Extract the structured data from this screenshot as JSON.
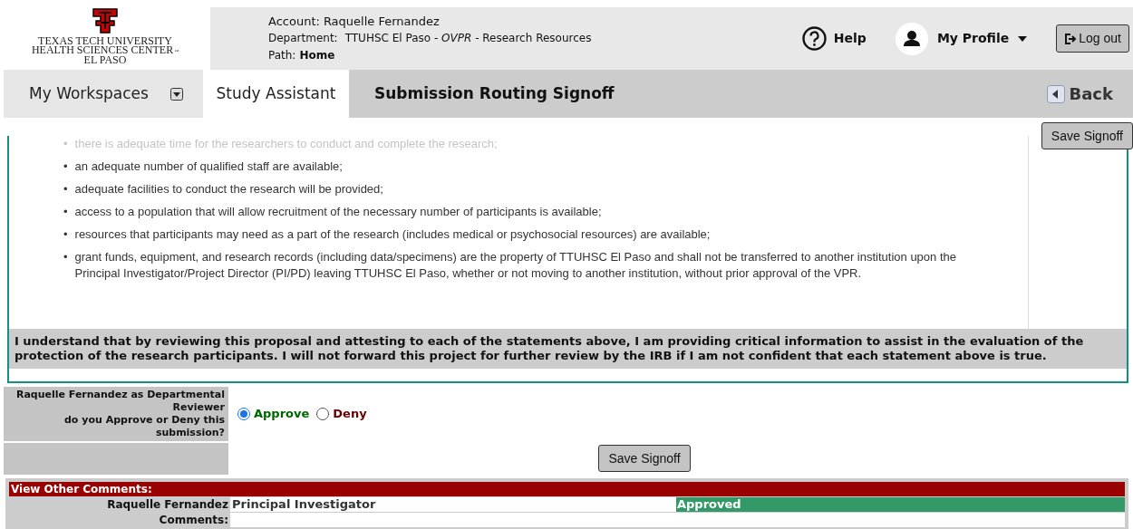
{
  "logo": {
    "lines": [
      "TEXAS TECH UNIVERSITY",
      "HEALTH SCIENCES CENTER",
      "EL PASO"
    ],
    "tm": "™"
  },
  "account": {
    "label": "Account:",
    "value": "Raquelle Fernandez"
  },
  "department": {
    "label": "Department:",
    "value": "TTUHSC El Paso - *OVPR* - Research Resources"
  },
  "path": {
    "label": "Path:",
    "value": "Home"
  },
  "header_actions": {
    "help": "Help",
    "profile": "My Profile",
    "logout": "Log out"
  },
  "tabs": [
    {
      "label": "My Workspaces",
      "kind": "dropdown",
      "selected": false
    },
    {
      "label": "Study Assistant",
      "kind": "plain",
      "selected": true
    }
  ],
  "page_title": "Submission Routing Signoff",
  "back": "Back",
  "top_save": "Save Signoff",
  "bullet_marker": "•",
  "bullets": [
    "there is adequate time for the researchers to conduct and complete the research;",
    "an adequate number of qualified staff are available;",
    "adequate facilities to conduct the research will be provided;",
    "access to a population that will allow recruitment of the necessary number of participants is available;",
    "resources that participants may need as a part of the research (includes medical or psychosocial resources) are available;",
    "grant funds, equipment, and research records (including data/specimens) are the property of TTUHSC El Paso and shall not be transferred to another institution upon the Principal Investigator/Project Director (PI/PD) leaving TTUHSC El Paso, whether or not moving to another institution, without prior approval of the VPR."
  ],
  "statement": "I understand that by reviewing this proposal and attesting to each of the statements above, I am providing critical information to assist in the evaluation of the protection of the research participants.  I will not forward this project for further review by the IRB if I am not confident that each statement above is true.",
  "signoff": {
    "question": [
      "Raquelle Fernandez as Departmental Reviewer",
      "do you Approve or Deny this submission?"
    ],
    "options": [
      {
        "label": "Approve",
        "selected": true,
        "color": "#006600"
      },
      {
        "label": "Deny",
        "selected": false,
        "color": "#660000"
      }
    ],
    "save": "Save Signoff"
  },
  "comments": {
    "header": "View Other Comments:",
    "rows": [
      {
        "name": "Raquelle Fernandez",
        "role": "Principal Investigator",
        "status": "Approved",
        "color": "#339966"
      }
    ],
    "comments_label": "Comments:"
  }
}
